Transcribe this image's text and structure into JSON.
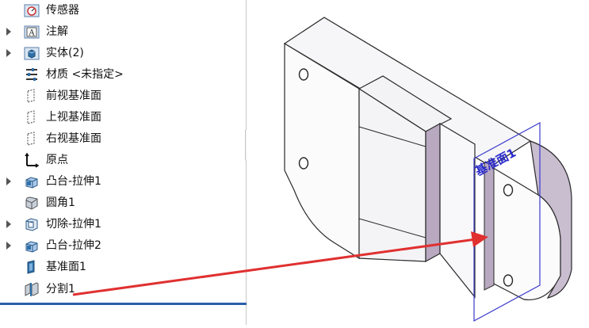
{
  "feature_tree": {
    "items": [
      {
        "label": "传感器",
        "icon": "sensor-icon",
        "expandable": false
      },
      {
        "label": "注解",
        "icon": "annotation-icon",
        "expandable": true
      },
      {
        "label": "实体(2)",
        "icon": "solid-bodies-icon",
        "expandable": true
      },
      {
        "label": "材质 <未指定>",
        "icon": "material-icon",
        "expandable": false
      },
      {
        "label": "前视基准面",
        "icon": "plane-icon",
        "expandable": false
      },
      {
        "label": "上视基准面",
        "icon": "plane-icon",
        "expandable": false
      },
      {
        "label": "右视基准面",
        "icon": "plane-icon",
        "expandable": false
      },
      {
        "label": "原点",
        "icon": "origin-icon",
        "expandable": false
      },
      {
        "label": "凸台-拉伸1",
        "icon": "boss-extrude-icon",
        "expandable": true
      },
      {
        "label": "圆角1",
        "icon": "fillet-icon",
        "expandable": false
      },
      {
        "label": "切除-拉伸1",
        "icon": "cut-extrude-icon",
        "expandable": true
      },
      {
        "label": "凸台-拉伸2",
        "icon": "boss-extrude-icon",
        "expandable": true
      },
      {
        "label": "基准面1",
        "icon": "plane1-icon",
        "expandable": false
      },
      {
        "label": "分割1",
        "icon": "split-icon",
        "expandable": false
      }
    ]
  },
  "viewport": {
    "plane_label": "基准面1"
  },
  "colors": {
    "selection_line": "#2b5fa8",
    "plane_outline": "#3a3acc",
    "arrow": "#e03030",
    "part_face": "#f2f2f4",
    "part_side": "#b8a8c0"
  }
}
